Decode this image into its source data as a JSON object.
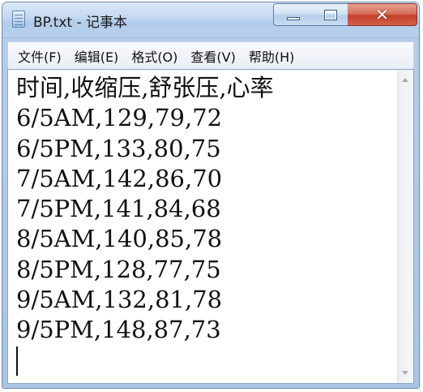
{
  "window": {
    "title": "BP.txt - 记事本",
    "close_glyph": "✕"
  },
  "menu": {
    "items": [
      {
        "label": "文件(F)"
      },
      {
        "label": "编辑(E)"
      },
      {
        "label": "格式(O)"
      },
      {
        "label": "查看(V)"
      },
      {
        "label": "帮助(H)"
      }
    ]
  },
  "document": {
    "lines": [
      "时间,收缩压,舒张压,心率",
      "6/5AM,129,79,72",
      "6/5PM,133,80,75",
      "7/5AM,142,86,70",
      "7/5PM,141,84,68",
      "8/5AM,140,85,78",
      "8/5PM,128,77,75",
      "9/5AM,132,81,78",
      "9/5PM,148,87,73"
    ]
  },
  "icons": {
    "app": "notepad-icon",
    "minimize": "minimize-icon",
    "maximize": "maximize-icon",
    "close": "close-icon",
    "scroll_up": "scroll-up-arrow-icon",
    "scroll_down": "scroll-down-arrow-icon"
  },
  "colors": {
    "close_button": "#c4402a",
    "title_bar": "#c3d8f1",
    "editor_background": "#ffffff"
  }
}
